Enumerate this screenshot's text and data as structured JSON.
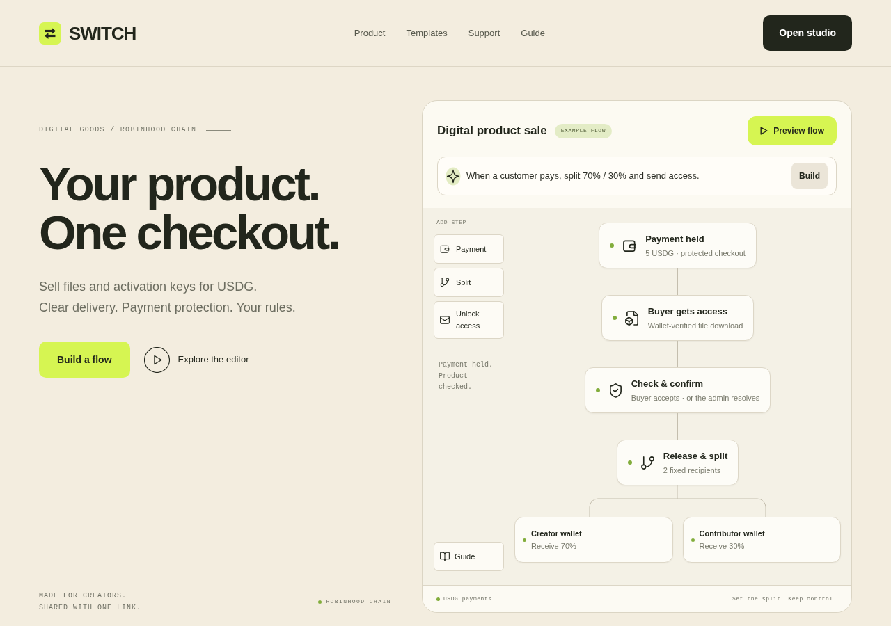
{
  "header": {
    "brand": "SWITCH",
    "nav": [
      {
        "label": "Product"
      },
      {
        "label": "Templates"
      },
      {
        "label": "Support"
      },
      {
        "label": "Guide"
      }
    ],
    "cta": "Open studio"
  },
  "hero": {
    "eyebrow": "DIGITAL GOODS / ROBINHOOD CHAIN",
    "headline": [
      "Your product.",
      "One checkout."
    ],
    "subtitle": [
      "Sell files and activation keys for USDG.",
      "Clear delivery. Payment protection. Your rules."
    ],
    "primary_button": "Build a flow",
    "secondary_link": "Explore the editor"
  },
  "footer": {
    "tagline": [
      "MADE FOR CREATORS.",
      "SHARED WITH ONE LINK."
    ],
    "network": "ROBINHOOD CHAIN"
  },
  "editor": {
    "title": "Digital product sale",
    "badge": "EXAMPLE FLOW",
    "preview_button": "Preview flow",
    "prompt": {
      "value": "When a customer pays, split 70% / 30% and send access."
    },
    "build_button": "Build",
    "palette": {
      "heading": "ADD STEP",
      "items": [
        {
          "label": "Payment"
        },
        {
          "label": "Split"
        },
        {
          "label": "Unlock access"
        }
      ],
      "note": "Payment held. Product checked.",
      "guide": "Guide"
    },
    "steps": [
      {
        "title": "Payment held",
        "subtitle": "5 USDG · protected checkout"
      },
      {
        "title": "Buyer gets access",
        "subtitle": "Wallet-verified file download"
      },
      {
        "title": "Check & confirm",
        "subtitle": "Buyer accepts · or the admin resolves"
      },
      {
        "title": "Release & split",
        "subtitle": "2 fixed recipients"
      }
    ],
    "recipients": [
      {
        "title": "Creator wallet",
        "subtitle": "Receive 70%"
      },
      {
        "title": "Contributor wallet",
        "subtitle": "Receive 30%"
      }
    ],
    "status_bar": {
      "left": "USDG payments",
      "right": "Set the split. Keep control."
    }
  }
}
